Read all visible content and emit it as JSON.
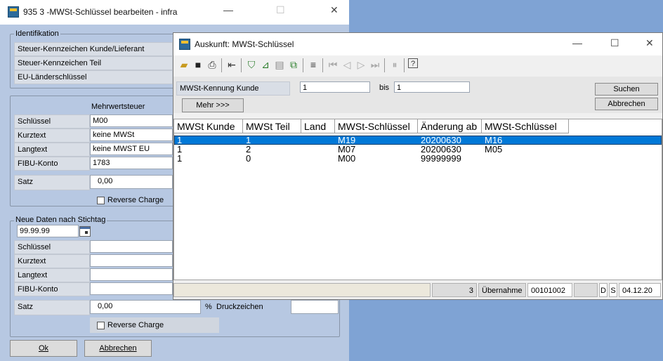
{
  "bg_window": {
    "title": "935  3 -MWSt-Schlüssel bearbeiten - infra",
    "identifikation": {
      "legend": "Identifikation",
      "rows": [
        "Steuer-Kennzeichen Kunde/Lieferant",
        "Steuer-Kennzeichen Teil",
        "EU-Länderschlüssel"
      ]
    },
    "current": {
      "column_header": "Mehrwertsteuer",
      "schluessel_label": "Schlüssel",
      "schluessel_value": "M00",
      "kurztext_label": "Kurztext",
      "kurztext_value": "keine MWSt",
      "langtext_label": "Langtext",
      "langtext_value": "keine MWST EU",
      "fibu_label": "FIBU-Konto",
      "fibu_value": "1783",
      "satz_label": "Satz",
      "satz_value": "0,00",
      "reverse_label": "Reverse Charge"
    },
    "neu": {
      "legend": "Neue Daten nach Stichtag",
      "date_value": "99.99.99",
      "schluessel_label": "Schlüssel",
      "kurztext_label": "Kurztext",
      "langtext_label": "Langtext",
      "fibu_label": "FIBU-Konto",
      "satz_label": "Satz",
      "satz_value": "0,00",
      "percent": "%",
      "druck_label": "Druckzeichen",
      "reverse_label": "Reverse Charge"
    },
    "ok_label": "Ok",
    "cancel_label": "Abbrechen"
  },
  "dialog": {
    "title": "Auskunft:  MWSt-Schlüssel",
    "filter": {
      "label": "MWSt-Kennung Kunde",
      "from_value": "1",
      "bis_label": "bis",
      "to_value": "1",
      "more_label": "Mehr >>>",
      "search_label": "Suchen",
      "cancel_label": "Abbrechen"
    },
    "grid": {
      "columns": [
        "MWSt Kunde",
        "MWSt Teil",
        "Land",
        "MWSt-Schlüssel",
        "Änderung ab",
        "MWSt-Schlüssel"
      ],
      "rows": [
        [
          "1",
          "1",
          "",
          "M19",
          "20200630",
          "M16"
        ],
        [
          "1",
          "2",
          "",
          "M07",
          "20200630",
          "M05"
        ],
        [
          "1",
          "0",
          "",
          "M00",
          "99999999",
          ""
        ]
      ]
    },
    "status": {
      "count": "3",
      "action": "Übernahme",
      "code": "00101002",
      "flag_d": "D",
      "flag_s": "S",
      "date": "04.12.20"
    }
  }
}
